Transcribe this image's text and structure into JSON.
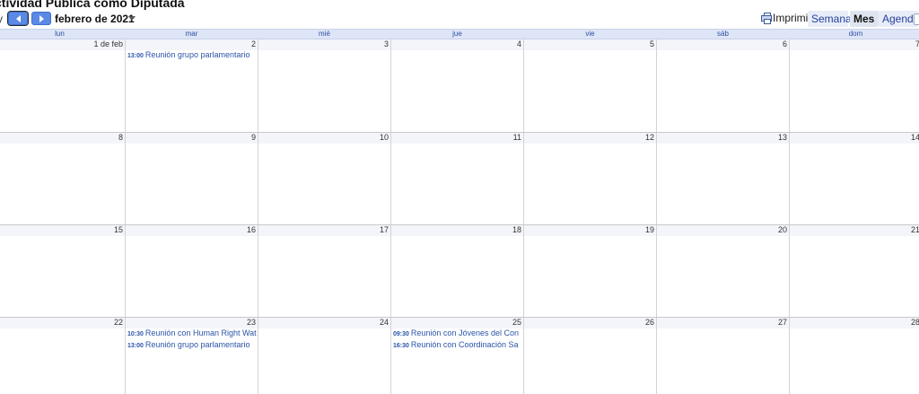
{
  "header": {
    "title": "ctividad Pública como Diputada",
    "today_fragment": "y",
    "month_label": "febrero de 2021",
    "print_label": "Imprimir",
    "views": {
      "week": "Semana",
      "month": "Mes",
      "agenda": "Agenda"
    }
  },
  "weekdays": [
    "lun",
    "mar",
    "mié",
    "jue",
    "vie",
    "sáb",
    "dom"
  ],
  "weeks": [
    {
      "days": [
        {
          "label": "1 de feb",
          "events": []
        },
        {
          "label": "2",
          "events": [
            {
              "time": "13:00",
              "title": "Reunión grupo parlamentario"
            }
          ]
        },
        {
          "label": "3",
          "events": []
        },
        {
          "label": "4",
          "events": []
        },
        {
          "label": "5",
          "events": []
        },
        {
          "label": "6",
          "events": []
        },
        {
          "label": "7",
          "events": []
        }
      ]
    },
    {
      "days": [
        {
          "label": "8",
          "events": []
        },
        {
          "label": "9",
          "events": []
        },
        {
          "label": "10",
          "events": []
        },
        {
          "label": "11",
          "events": []
        },
        {
          "label": "12",
          "events": []
        },
        {
          "label": "13",
          "events": []
        },
        {
          "label": "14",
          "events": []
        }
      ]
    },
    {
      "days": [
        {
          "label": "15",
          "events": []
        },
        {
          "label": "16",
          "events": []
        },
        {
          "label": "17",
          "events": []
        },
        {
          "label": "18",
          "events": []
        },
        {
          "label": "19",
          "events": []
        },
        {
          "label": "20",
          "events": []
        },
        {
          "label": "21",
          "events": []
        }
      ]
    },
    {
      "days": [
        {
          "label": "22",
          "events": []
        },
        {
          "label": "23",
          "events": [
            {
              "time": "10:30",
              "title": "Reunión con Human Right Watch"
            },
            {
              "time": "13:00",
              "title": "Reunión grupo parlamentario"
            }
          ]
        },
        {
          "label": "24",
          "events": []
        },
        {
          "label": "25",
          "events": [
            {
              "time": "09:30",
              "title": "Reunión con Jóvenes del Con"
            },
            {
              "time": "16:30",
              "title": "Reunión con Coordinación Sa"
            }
          ]
        },
        {
          "label": "26",
          "events": []
        },
        {
          "label": "27",
          "events": []
        },
        {
          "label": "28",
          "events": []
        }
      ]
    }
  ]
}
